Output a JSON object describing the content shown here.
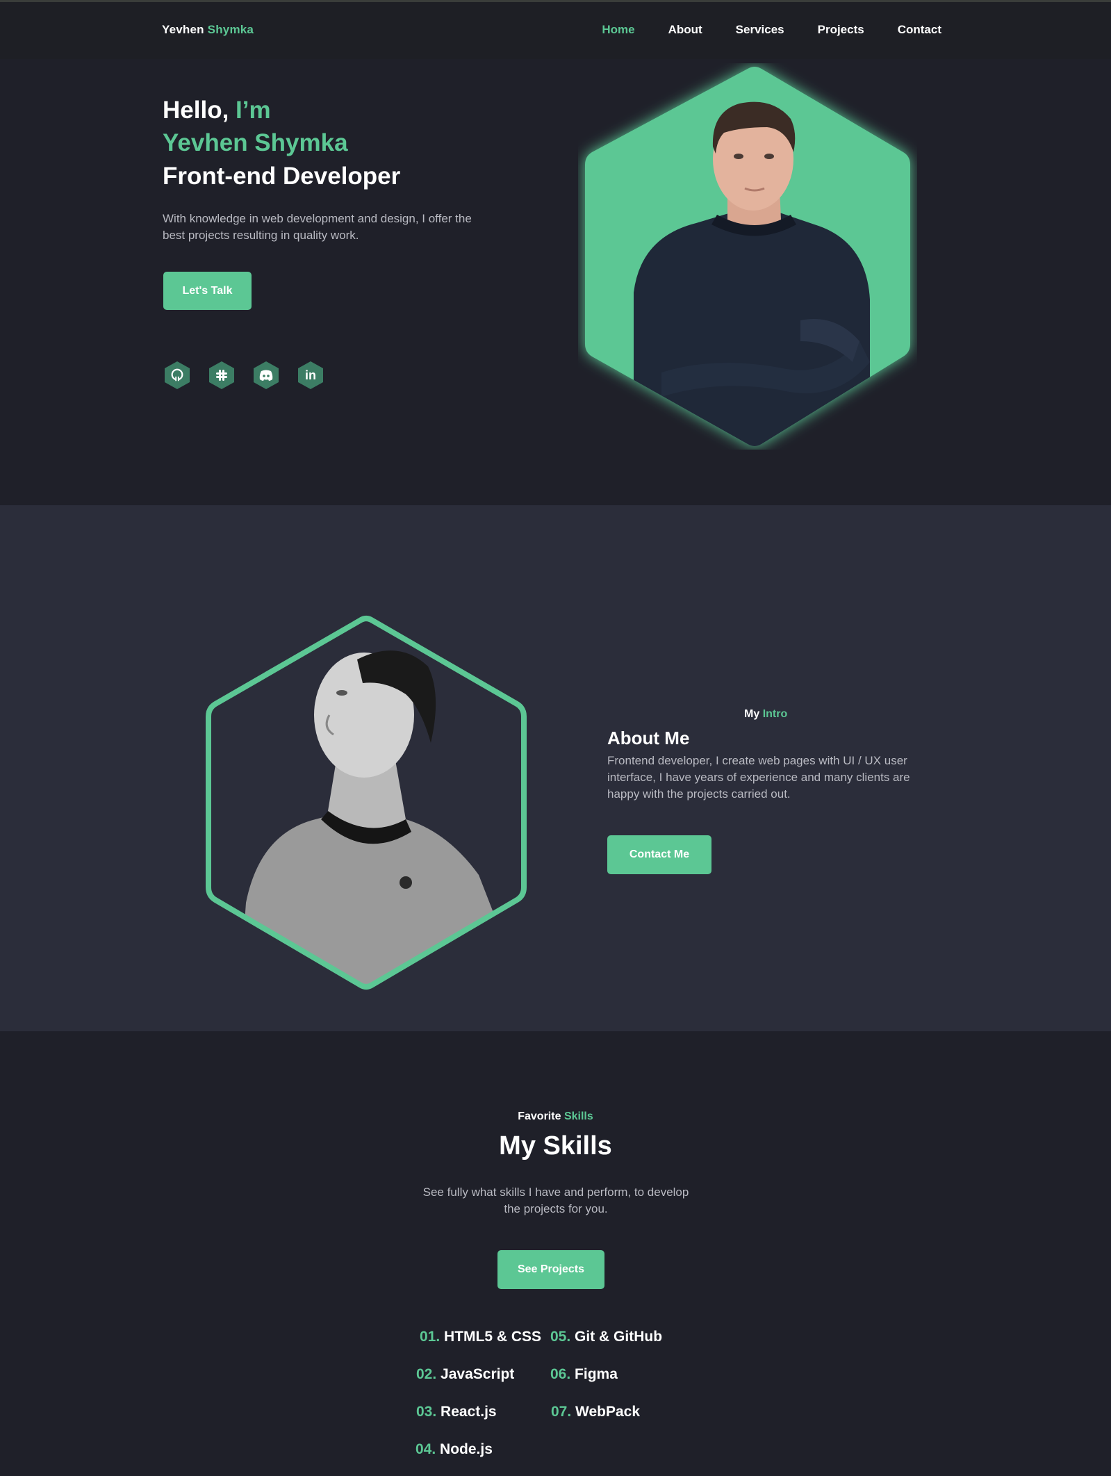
{
  "header": {
    "logo_first": "Yevhen",
    "logo_last": "Shymka",
    "nav": [
      {
        "label": "Home",
        "active": true
      },
      {
        "label": "About",
        "active": false
      },
      {
        "label": "Services",
        "active": false
      },
      {
        "label": "Projects",
        "active": false
      },
      {
        "label": "Contact",
        "active": false
      }
    ]
  },
  "hero": {
    "greeting": "Hello,",
    "greeting_accent": "I’m",
    "name": "Yevhen Shymka",
    "role": "Front-end Developer",
    "description": "With knowledge in web development and design, I offer the best projects resulting in quality work.",
    "cta_label": "Let's Talk",
    "socials": [
      {
        "icon": "github-icon"
      },
      {
        "icon": "slack-icon"
      },
      {
        "icon": "discord-icon"
      },
      {
        "icon": "linkedin-icon",
        "glyph": "in"
      }
    ]
  },
  "about": {
    "sub_first": "My",
    "sub_accent": "Intro",
    "title": "About Me",
    "description": "Frontend developer, I create web pages with UI / UX user interface, I have years of experience and many clients are happy with the projects carried out.",
    "cta_label": "Contact Me"
  },
  "skills": {
    "sub_first": "Favorite",
    "sub_accent": "Skills",
    "title": "My Skills",
    "description": "See fully what skills I have and perform, to develop the projects for you.",
    "cta_label": "See Projects",
    "items": [
      {
        "num": "01.",
        "name": "HTML5 & CSS"
      },
      {
        "num": "02.",
        "name": "JavaScript"
      },
      {
        "num": "03.",
        "name": "React.js"
      },
      {
        "num": "04.",
        "name": "Node.js"
      },
      {
        "num": "05.",
        "name": "Git & GitHub"
      },
      {
        "num": "06.",
        "name": "Figma"
      },
      {
        "num": "07.",
        "name": "WebPack"
      }
    ]
  },
  "colors": {
    "accent": "#5cc794",
    "background": "#1f2029",
    "section_alt": "#2b2d3a",
    "header": "#1e1f25",
    "muted_text": "#b9bac2"
  }
}
